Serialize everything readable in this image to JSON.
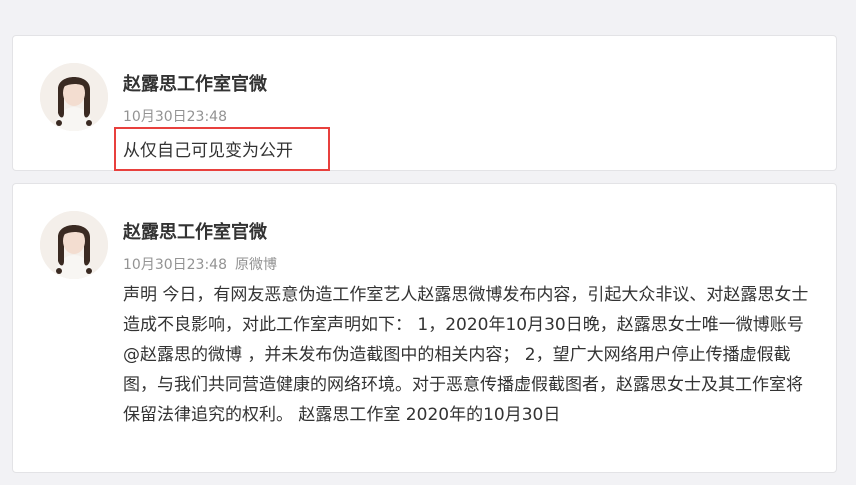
{
  "posts": [
    {
      "author": "赵露思工作室官微",
      "time": "10月30日23:48",
      "text": "从仅自己可见变为公开",
      "highlight_color": "#e8403d"
    },
    {
      "author": "赵露思工作室官微",
      "time": "10月30日23:48",
      "source": "原微博",
      "text": "声明 今日，有网友恶意伪造工作室艺人赵露思微博发布内容，引起大众非议、对赵露思女士造成不良影响，对此工作室声明如下： 1，2020年10月30日晚，赵露思女士唯一微博账号@赵露思的微博 ，并未发布伪造截图中的相关内容； 2，望广大网络用户停止传播虚假截图，与我们共同营造健康的网络环境。对于恶意传播虚假截图者，赵露思女士及其工作室将保留法律追究的权利。 赵露思工作室 2020年的10月30日"
    }
  ]
}
